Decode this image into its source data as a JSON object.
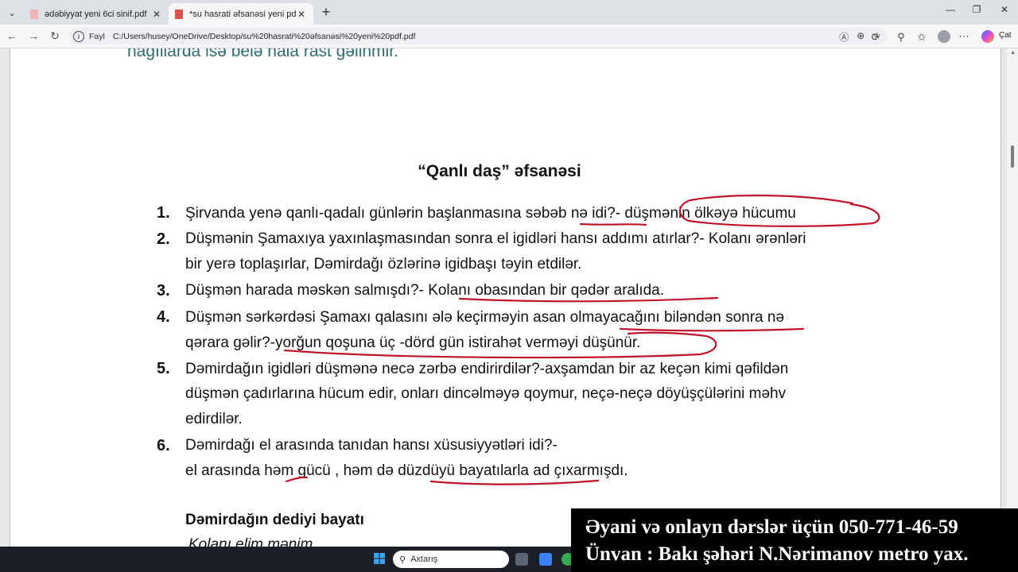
{
  "browser": {
    "tabs": [
      {
        "title": "ədəbiyyat yeni 6ci sinif.pdf",
        "active": false
      },
      {
        "title": "*su hasrati əfsanəsi yeni pdf.pdf",
        "active": true
      }
    ],
    "address": {
      "scheme_label": "Fayl",
      "url": "C:/Users/husey/OneDrive/Desktop/su%20hasrati%20əfsanəsi%20yeni%20pdf.pdf"
    },
    "chat_label": "Çat"
  },
  "document": {
    "cut_top_text": "nağıllarda isə belə hala rast gəlinmir.",
    "title": "“Qanlı daş” əfsanəsi",
    "items": [
      {
        "num": "1.",
        "lines": [
          "Şirvanda yenə qanlı-qadalı günlərin başlanmasına səbəb nə idi?- düşmənin ölkəyə  hücumu"
        ]
      },
      {
        "num": "2.",
        "lines": [
          "Düşmənin Şamaxıya yaxınlaşmasından sonra el igidləri hansı addımı atırlar?- Kolanı ərənləri",
          "bir yerə toplaşırlar, Dəmirdağı özlərinə igidbaşı təyin etdilər."
        ]
      },
      {
        "num": "3.",
        "lines": [
          "Düşmən harada məskən salmışdı?- Kolanı obasından bir qədər aralıda."
        ]
      },
      {
        "num": "4.",
        "lines": [
          "Düşmən sərkərdəsi Şamaxı qalasını  ələ keçirməyin asan olmayacağını biləndən sonra nə",
          "qərara gəlir?-yorğun qoşuna üç -dörd gün istirahət verməyi düşünür."
        ]
      },
      {
        "num": "5.",
        "lines": [
          "Dəmirdağın igidləri düşmənə necə zərbə endirirdilər?-axşamdan bir az keçən kimi qəfildən",
          "düşmən çadırlarına hücum edir, onları dincəlməyə qoymur, neçə-neçə döyüşçülərini məhv",
          "edirdilər."
        ]
      },
      {
        "num": "6.",
        "lines": [
          "Dəmirdağı el arasında tanıdan hansı xüsusiyyətləri idi?-",
          "el arasında həm gücü , həm də düzdüyü bayatılarla  ad çıxarmışdı."
        ]
      }
    ],
    "subheading": "Dəmirdağın  dediyi bayatı",
    "cutoff_line": "Kolanı elim mənim"
  },
  "taskbar": {
    "search_placeholder": "Axtarış"
  },
  "banner": {
    "line1": "Əyani və onlayn dərslər üçün 050-771-46-59",
    "line2": "Ünvan : Bakı şəhəri N.Nərimanov metro yax."
  },
  "colors": {
    "annotation": "#c0142a",
    "teal_text": "#2e6b74",
    "pdf_icon": "#d9534f"
  }
}
